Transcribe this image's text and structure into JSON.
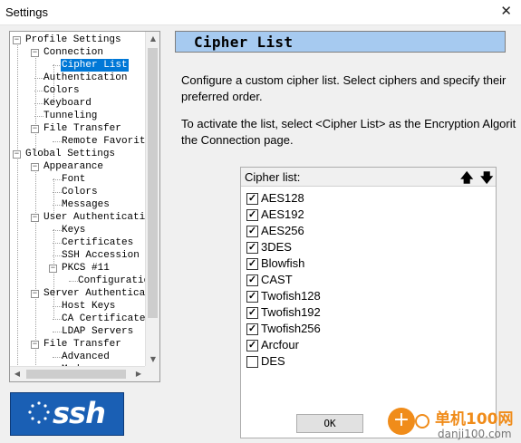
{
  "window": {
    "title": "Settings",
    "close_glyph": "✕"
  },
  "tree": {
    "items": [
      {
        "label": "Profile Settings",
        "level": 0,
        "toggle": "−"
      },
      {
        "label": "Connection",
        "level": 1,
        "toggle": "−"
      },
      {
        "label": "Cipher List",
        "level": 2,
        "selected": true
      },
      {
        "label": "Authentication",
        "level": 1
      },
      {
        "label": "Colors",
        "level": 1
      },
      {
        "label": "Keyboard",
        "level": 1
      },
      {
        "label": "Tunneling",
        "level": 1
      },
      {
        "label": "File Transfer",
        "level": 1,
        "toggle": "−"
      },
      {
        "label": "Remote Favorite",
        "level": 2
      },
      {
        "label": "Global Settings",
        "level": 0,
        "toggle": "−"
      },
      {
        "label": "Appearance",
        "level": 1,
        "toggle": "−"
      },
      {
        "label": "Font",
        "level": 2
      },
      {
        "label": "Colors",
        "level": 2
      },
      {
        "label": "Messages",
        "level": 2
      },
      {
        "label": "User Authenticatio",
        "level": 1,
        "toggle": "−"
      },
      {
        "label": "Keys",
        "level": 2
      },
      {
        "label": "Certificates",
        "level": 2
      },
      {
        "label": "SSH Accession",
        "level": 2
      },
      {
        "label": "PKCS #11",
        "level": 2,
        "toggle": "−"
      },
      {
        "label": "Configuratio",
        "level": 3
      },
      {
        "label": "Server Authenticat",
        "level": 1,
        "toggle": "−"
      },
      {
        "label": "Host Keys",
        "level": 2
      },
      {
        "label": "CA Certificates",
        "level": 2
      },
      {
        "label": "LDAP Servers",
        "level": 2
      },
      {
        "label": "File Transfer",
        "level": 1,
        "toggle": "−"
      },
      {
        "label": "Advanced",
        "level": 2
      },
      {
        "label": "Mode",
        "level": 2
      }
    ]
  },
  "logo": {
    "text": "ssh"
  },
  "panel": {
    "header": "Cipher List",
    "desc1_line1": "Configure a custom cipher list. Select ciphers and specify their",
    "desc1_line2": "preferred order.",
    "desc2_line1": "To activate the list, select <Cipher List> as the Encryption Algorit",
    "desc2_line2": "the Connection page."
  },
  "cipher_list": {
    "header": "Cipher list:",
    "move_up_glyph": "🡅",
    "move_down_glyph": "🡇",
    "items": [
      {
        "label": "AES128",
        "checked": true
      },
      {
        "label": "AES192",
        "checked": true
      },
      {
        "label": "AES256",
        "checked": true
      },
      {
        "label": "3DES",
        "checked": true
      },
      {
        "label": "Blowfish",
        "checked": true
      },
      {
        "label": "CAST",
        "checked": true
      },
      {
        "label": "Twofish128",
        "checked": true
      },
      {
        "label": "Twofish192",
        "checked": true
      },
      {
        "label": "Twofish256",
        "checked": true
      },
      {
        "label": "Arcfour",
        "checked": true
      },
      {
        "label": "DES",
        "checked": false
      }
    ]
  },
  "ok_button": {
    "label": "OK"
  },
  "watermark": {
    "line1": "单机100网",
    "line2": "danji100.com",
    "plus_glyph": "+"
  },
  "colors": {
    "selection": "#0078d7",
    "header_bar": "#a6caf0",
    "logo_bg": "#1a5fb4",
    "watermark": "#f08c1a"
  }
}
